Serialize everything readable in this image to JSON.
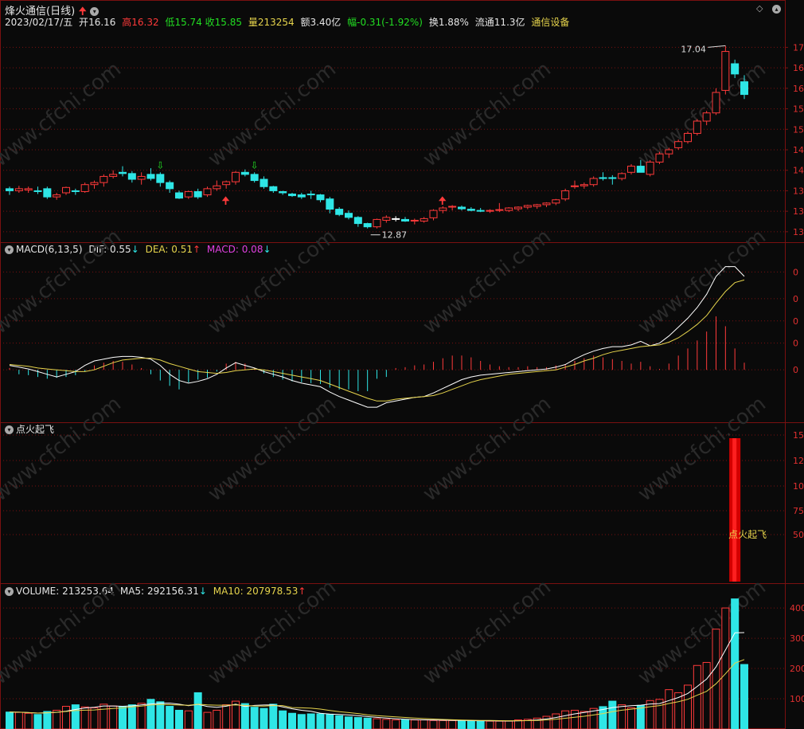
{
  "header": {
    "stock_name": "烽火通信",
    "period": "(日线)",
    "date": "2023/02/17/五",
    "open_label": "开",
    "open": "16.16",
    "high_label": "高",
    "high": "16.32",
    "low_label": "低",
    "low": "15.74",
    "close_label": "收",
    "close": "15.85",
    "volume_label": "量",
    "volume": "213254",
    "amount_label": "额",
    "amount": "3.40亿",
    "change_label": "幅",
    "change": "-0.31(-1.92%)",
    "turnover_label": "换",
    "turnover": "1.88%",
    "float_label": "流通",
    "float": "11.3亿",
    "sector": "通信设备"
  },
  "price_panel": {
    "y_ticks": [
      "17",
      "16",
      "16",
      "15",
      "15",
      "14",
      "14",
      "13",
      "13",
      "13"
    ],
    "high_mark": "17.04",
    "low_mark": "12.87"
  },
  "macd_panel": {
    "title": "MACD(6,13,5)",
    "dif_label": "DIF:",
    "dif": "0.55",
    "dea_label": "DEA:",
    "dea": "0.51",
    "macd_label": "MACD:",
    "macd": "0.08",
    "y_ticks": [
      "0",
      "0",
      "0",
      "0",
      "0"
    ]
  },
  "signal_panel": {
    "title": "点火起飞",
    "bar_label": "点火起飞",
    "y_ticks": [
      "15",
      "12",
      "10",
      "75",
      "50"
    ]
  },
  "volume_panel": {
    "vol_label": "VOLUME:",
    "vol": "213253.64",
    "ma5_label": "MA5:",
    "ma5": "292156.31",
    "ma10_label": "MA10:",
    "ma10": "207978.53",
    "y_ticks": [
      "400",
      "300",
      "200",
      "100"
    ]
  },
  "watermark": "www.cfchi.com",
  "colors": {
    "up": "#ff3a3a",
    "down": "#2ee6e6",
    "dea": "#e6d44c",
    "dif": "#ffffff",
    "grid": "#7a1010",
    "signal": "#d40000"
  },
  "chart_data": {
    "type": "candlestick",
    "candles": [
      [
        13.55,
        13.6,
        13.4,
        13.5
      ],
      [
        13.5,
        13.62,
        13.45,
        13.55
      ],
      [
        13.52,
        13.6,
        13.45,
        13.55
      ],
      [
        13.5,
        13.6,
        13.42,
        13.48
      ],
      [
        13.55,
        13.6,
        13.3,
        13.35
      ],
      [
        13.35,
        13.45,
        13.28,
        13.4
      ],
      [
        13.45,
        13.6,
        13.4,
        13.58
      ],
      [
        13.5,
        13.55,
        13.4,
        13.48
      ],
      [
        13.48,
        13.7,
        13.45,
        13.65
      ],
      [
        13.65,
        13.75,
        13.55,
        13.7
      ],
      [
        13.7,
        13.9,
        13.6,
        13.85
      ],
      [
        13.85,
        14.0,
        13.8,
        13.9
      ],
      [
        13.95,
        14.1,
        13.85,
        13.92
      ],
      [
        13.92,
        13.98,
        13.7,
        13.78
      ],
      [
        13.78,
        13.95,
        13.65,
        13.85
      ],
      [
        13.9,
        14.05,
        13.75,
        13.8
      ],
      [
        13.9,
        13.95,
        13.6,
        13.7
      ],
      [
        13.7,
        13.75,
        13.45,
        13.55
      ],
      [
        13.45,
        13.5,
        13.3,
        13.32
      ],
      [
        13.35,
        13.5,
        13.3,
        13.48
      ],
      [
        13.48,
        13.55,
        13.3,
        13.35
      ],
      [
        13.4,
        13.6,
        13.35,
        13.55
      ],
      [
        13.55,
        13.75,
        13.5,
        13.62
      ],
      [
        13.65,
        13.75,
        13.55,
        13.72
      ],
      [
        13.72,
        13.98,
        13.65,
        13.95
      ],
      [
        13.95,
        14.02,
        13.85,
        13.9
      ],
      [
        13.9,
        13.95,
        13.7,
        13.75
      ],
      [
        13.78,
        13.85,
        13.55,
        13.6
      ],
      [
        13.6,
        13.62,
        13.45,
        13.5
      ],
      [
        13.48,
        13.5,
        13.4,
        13.45
      ],
      [
        13.42,
        13.45,
        13.35,
        13.38
      ],
      [
        13.4,
        13.45,
        13.3,
        13.35
      ],
      [
        13.42,
        13.5,
        13.3,
        13.4
      ],
      [
        13.4,
        13.42,
        13.22,
        13.28
      ],
      [
        13.3,
        13.35,
        12.95,
        13.05
      ],
      [
        13.05,
        13.1,
        12.88,
        12.92
      ],
      [
        12.95,
        13.02,
        12.8,
        12.85
      ],
      [
        12.85,
        12.88,
        12.62,
        12.7
      ],
      [
        12.7,
        12.72,
        12.58,
        12.62
      ],
      [
        12.62,
        12.82,
        12.58,
        12.8
      ],
      [
        12.78,
        12.9,
        12.72,
        12.85
      ],
      [
        12.82,
        12.88,
        12.75,
        12.82
      ],
      [
        12.8,
        12.86,
        12.74,
        12.76
      ],
      [
        12.76,
        12.82,
        12.68,
        12.78
      ],
      [
        12.76,
        12.86,
        12.72,
        12.82
      ],
      [
        12.84,
        13.05,
        12.78,
        13.02
      ],
      [
        13.02,
        13.12,
        12.95,
        13.08
      ],
      [
        13.1,
        13.15,
        13.02,
        13.12
      ],
      [
        13.1,
        13.14,
        13.02,
        13.06
      ],
      [
        13.05,
        13.1,
        13.0,
        13.02
      ],
      [
        13.02,
        13.08,
        12.98,
        13.0
      ],
      [
        13.0,
        13.05,
        12.96,
        13.02
      ],
      [
        13.02,
        13.2,
        12.98,
        13.04
      ],
      [
        13.02,
        13.1,
        12.98,
        13.08
      ],
      [
        13.06,
        13.12,
        13.0,
        13.1
      ],
      [
        13.1,
        13.16,
        13.05,
        13.14
      ],
      [
        13.12,
        13.18,
        13.06,
        13.16
      ],
      [
        13.16,
        13.22,
        13.1,
        13.2
      ],
      [
        13.2,
        13.3,
        13.15,
        13.28
      ],
      [
        13.3,
        13.55,
        13.25,
        13.5
      ],
      [
        13.6,
        13.75,
        13.55,
        13.62
      ],
      [
        13.62,
        13.7,
        13.55,
        13.65
      ],
      [
        13.65,
        13.85,
        13.6,
        13.8
      ],
      [
        13.82,
        13.95,
        13.75,
        13.8
      ],
      [
        13.82,
        13.88,
        13.65,
        13.8
      ],
      [
        13.8,
        13.95,
        13.75,
        13.92
      ],
      [
        13.95,
        14.15,
        13.9,
        14.1
      ],
      [
        14.1,
        14.25,
        14.0,
        13.95
      ],
      [
        13.9,
        14.25,
        13.85,
        14.2
      ],
      [
        14.2,
        14.45,
        14.15,
        14.4
      ],
      [
        14.4,
        14.55,
        14.3,
        14.5
      ],
      [
        14.55,
        14.75,
        14.5,
        14.7
      ],
      [
        14.7,
        14.95,
        14.65,
        14.9
      ],
      [
        14.9,
        15.25,
        14.85,
        15.2
      ],
      [
        15.2,
        15.45,
        15.1,
        15.4
      ],
      [
        15.4,
        16.0,
        15.35,
        15.9
      ],
      [
        15.95,
        17.04,
        15.85,
        16.9
      ],
      [
        16.6,
        16.7,
        16.25,
        16.35
      ],
      [
        16.16,
        16.32,
        15.74,
        15.85
      ]
    ],
    "volume": [
      56000,
      55000,
      52000,
      48000,
      58000,
      62000,
      75000,
      80000,
      73000,
      70000,
      82000,
      76000,
      74000,
      80000,
      85000,
      98000,
      90000,
      75000,
      62000,
      60000,
      120000,
      55000,
      62000,
      80000,
      92000,
      84000,
      72000,
      68000,
      82000,
      60000,
      52000,
      48000,
      50000,
      50000,
      48000,
      44000,
      40000,
      38000,
      36000,
      34000,
      32000,
      30000,
      30000,
      30000,
      30000,
      28000,
      28000,
      28000,
      27000,
      27000,
      27000,
      26000,
      26000,
      26000,
      30000,
      32000,
      36000,
      42000,
      50000,
      60000,
      62000,
      58000,
      68000,
      74000,
      92000,
      80000,
      70000,
      78000,
      94000,
      98000,
      130000,
      120000,
      145000,
      210000,
      220000,
      330000,
      400000,
      430000,
      213254
    ],
    "macd_hist": [
      0.02,
      -0.05,
      -0.06,
      -0.08,
      -0.1,
      -0.09,
      -0.08,
      -0.06,
      -0.02,
      0.05,
      0.08,
      0.1,
      0.09,
      0.06,
      0.02,
      -0.05,
      -0.12,
      -0.18,
      -0.22,
      -0.14,
      -0.11,
      -0.09,
      -0.02,
      0.07,
      0.09,
      0.07,
      0.02,
      -0.04,
      -0.08,
      -0.11,
      -0.13,
      -0.14,
      -0.15,
      -0.16,
      -0.2,
      -0.22,
      -0.22,
      -0.24,
      -0.24,
      -0.1,
      -0.08,
      0.02,
      0.03,
      0.05,
      0.06,
      0.09,
      0.13,
      0.16,
      0.16,
      0.14,
      0.1,
      0.06,
      0.04,
      0.03,
      0.03,
      0.04,
      0.03,
      0.03,
      0.05,
      0.06,
      0.1,
      0.13,
      0.16,
      0.14,
      0.12,
      0.1,
      0.07,
      0.09,
      0.04,
      0.01,
      0.07,
      0.16,
      0.24,
      0.33,
      0.43,
      0.6,
      0.49,
      0.24,
      0.08
    ],
    "dif": [
      0.05,
      0.03,
      0.01,
      -0.02,
      -0.05,
      -0.08,
      -0.05,
      -0.02,
      0.05,
      0.1,
      0.12,
      0.14,
      0.15,
      0.15,
      0.14,
      0.12,
      0.05,
      -0.05,
      -0.12,
      -0.15,
      -0.13,
      -0.1,
      -0.05,
      0.02,
      0.08,
      0.05,
      0.02,
      -0.02,
      -0.05,
      -0.08,
      -0.12,
      -0.15,
      -0.17,
      -0.19,
      -0.25,
      -0.3,
      -0.34,
      -0.38,
      -0.42,
      -0.42,
      -0.37,
      -0.35,
      -0.33,
      -0.31,
      -0.3,
      -0.26,
      -0.21,
      -0.16,
      -0.11,
      -0.08,
      -0.06,
      -0.05,
      -0.04,
      -0.03,
      -0.02,
      -0.01,
      0.0,
      0.01,
      0.03,
      0.06,
      0.12,
      0.17,
      0.21,
      0.24,
      0.26,
      0.26,
      0.28,
      0.32,
      0.27,
      0.3,
      0.38,
      0.48,
      0.58,
      0.7,
      0.85,
      1.05,
      1.16,
      1.16,
      1.05
    ],
    "dea": [
      0.06,
      0.05,
      0.04,
      0.02,
      0.01,
      0.0,
      -0.01,
      -0.02,
      -0.02,
      0.0,
      0.04,
      0.08,
      0.11,
      0.12,
      0.13,
      0.13,
      0.11,
      0.07,
      0.04,
      0.01,
      -0.02,
      -0.03,
      -0.04,
      -0.03,
      -0.01,
      0.0,
      0.01,
      0.0,
      -0.02,
      -0.04,
      -0.06,
      -0.08,
      -0.1,
      -0.12,
      -0.16,
      -0.2,
      -0.24,
      -0.28,
      -0.32,
      -0.35,
      -0.35,
      -0.33,
      -0.32,
      -0.31,
      -0.3,
      -0.29,
      -0.26,
      -0.22,
      -0.18,
      -0.14,
      -0.11,
      -0.09,
      -0.07,
      -0.05,
      -0.04,
      -0.03,
      -0.02,
      -0.01,
      0.0,
      0.03,
      0.06,
      0.1,
      0.13,
      0.17,
      0.2,
      0.22,
      0.24,
      0.26,
      0.27,
      0.28,
      0.31,
      0.36,
      0.43,
      0.51,
      0.61,
      0.75,
      0.88,
      0.98,
      1.01
    ],
    "signal_bar_index": 77,
    "y_range": [
      12.4,
      17.3
    ]
  }
}
